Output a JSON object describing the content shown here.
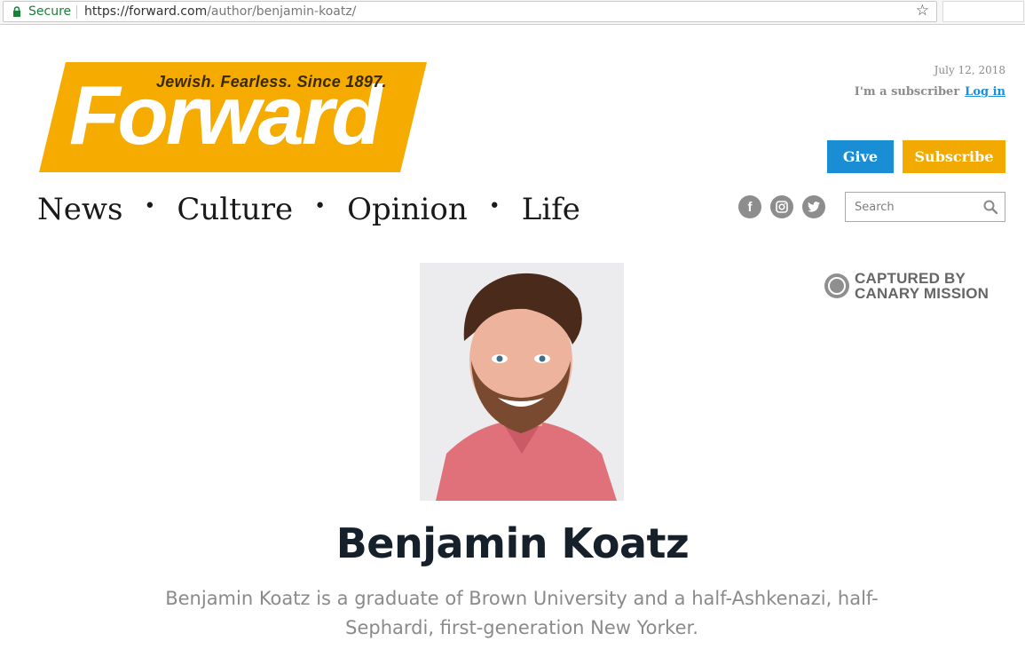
{
  "browser": {
    "secure_label": "Secure",
    "url_host": "https://forward.com",
    "url_path": "/author/benjamin-koatz/"
  },
  "logo": {
    "wordmark": "Forward",
    "tagline": "Jewish. Fearless. Since 1897.",
    "brand_color": "#f5ab00"
  },
  "header": {
    "date": "July 12, 2018",
    "subscriber_text": "I'm a subscriber",
    "login_label": "Log in",
    "give_label": "Give",
    "subscribe_label": "Subscribe"
  },
  "nav": {
    "items": [
      "News",
      "Culture",
      "Opinion",
      "Life"
    ],
    "separator": "•"
  },
  "social": {
    "icons": [
      "facebook-icon",
      "instagram-icon",
      "twitter-icon"
    ],
    "glyphs": {
      "facebook": "f",
      "twitter": "t"
    }
  },
  "search": {
    "placeholder": "Search"
  },
  "captured": {
    "line1": "CAPTURED BY",
    "line2": "CANARY MISSION"
  },
  "author": {
    "name": "Benjamin Koatz",
    "bio": "Benjamin Koatz is a graduate of Brown University and a half-Ashkenazi, half-Sephardi, first-generation New Yorker."
  },
  "colors": {
    "give": "#1a8ed5",
    "subscribe": "#f2a900",
    "link": "#1d8fd8"
  }
}
